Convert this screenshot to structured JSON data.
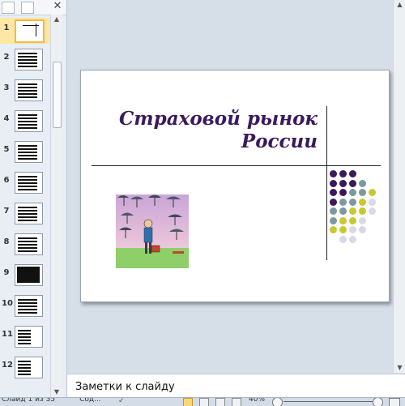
{
  "left_pane": {
    "thumbnails": [
      {
        "num": "1",
        "selected": true
      },
      {
        "num": "2",
        "selected": false
      },
      {
        "num": "3",
        "selected": false
      },
      {
        "num": "4",
        "selected": false
      },
      {
        "num": "5",
        "selected": false
      },
      {
        "num": "6",
        "selected": false
      },
      {
        "num": "7",
        "selected": false
      },
      {
        "num": "8",
        "selected": false
      },
      {
        "num": "9",
        "selected": false
      },
      {
        "num": "10",
        "selected": false
      },
      {
        "num": "11",
        "selected": false
      },
      {
        "num": "12",
        "selected": false
      }
    ]
  },
  "slide": {
    "title_line1": "Страховой рынок",
    "title_line2": "России",
    "title_color": "#3a1a5c",
    "dot_colors": [
      "#3a1a5c",
      "#7a9a9e",
      "#c8c832",
      "#d8d8e8"
    ]
  },
  "notes": {
    "label": "Заметки к слайду"
  },
  "status_bar": {
    "slide_info": "Слайд 1 из 35",
    "language": "\"Сод...",
    "zoom": "40%"
  }
}
